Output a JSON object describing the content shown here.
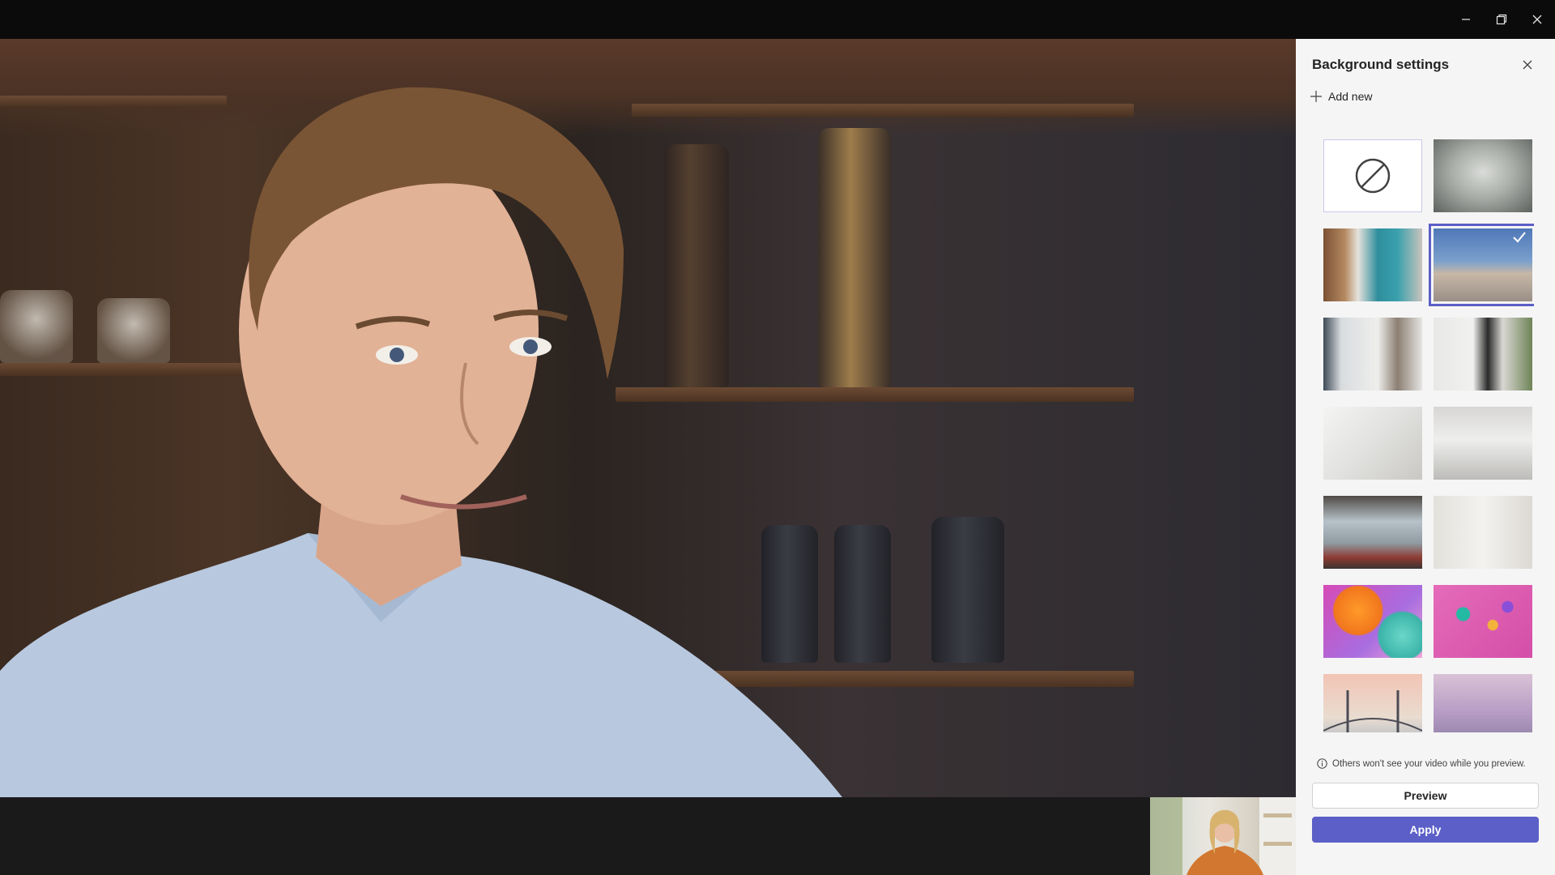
{
  "window": {
    "minimize_icon": "minimize-icon",
    "restore_icon": "restore-icon",
    "close_icon": "close-icon"
  },
  "panel": {
    "title": "Background settings",
    "add_new_label": "Add new",
    "info_text": "Others won't see your video while you preview.",
    "preview_label": "Preview",
    "apply_label": "Apply",
    "accent_color": "#5b5fc7",
    "selected_tile": "beach-vehicle"
  },
  "backgrounds": [
    {
      "name": "none",
      "icon": "none-icon"
    },
    {
      "name": "blur"
    },
    {
      "name": "office-lockers"
    },
    {
      "name": "beach-vehicle",
      "selected": true
    },
    {
      "name": "white-room-windows"
    },
    {
      "name": "room-mirror-plant"
    },
    {
      "name": "white-loft"
    },
    {
      "name": "empty-white-room"
    },
    {
      "name": "office-glass"
    },
    {
      "name": "white-wall-plants"
    },
    {
      "name": "balloons-orange"
    },
    {
      "name": "balloons-pink"
    },
    {
      "name": "bridge-pastel"
    },
    {
      "name": "rock-arch-pastel"
    }
  ]
}
